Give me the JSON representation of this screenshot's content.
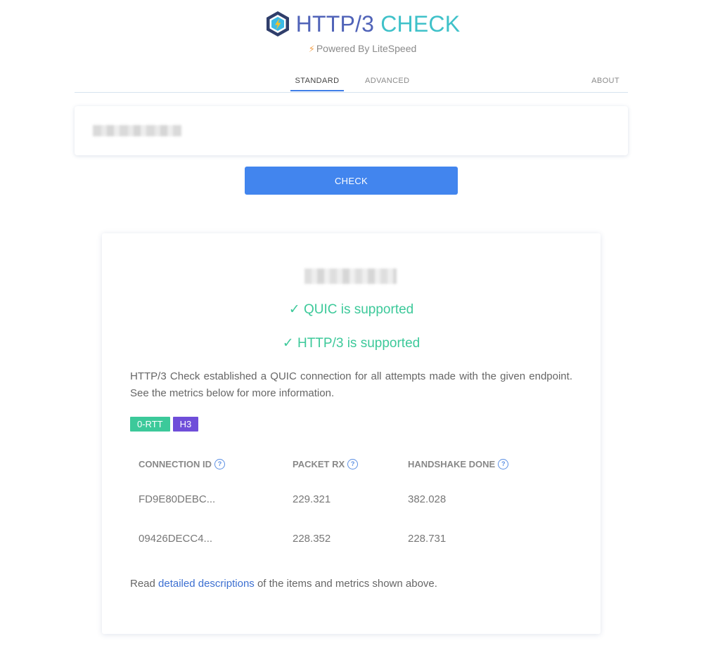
{
  "header": {
    "logo_http": "HTTP/3",
    "logo_check": "CHECK",
    "powered_by": "Powered By LiteSpeed"
  },
  "tabs": [
    {
      "label": "STANDARD",
      "active": true
    },
    {
      "label": "ADVANCED",
      "active": false
    },
    {
      "label": "ABOUT",
      "active": false
    }
  ],
  "input": {
    "value": "",
    "placeholder": ""
  },
  "check_button": {
    "label": "CHECK"
  },
  "result": {
    "quic_status": "✓ QUIC is supported",
    "h3_status": "✓ HTTP/3 is supported",
    "summary": "HTTP/3 Check established a QUIC connection for all attempts made with the given endpoint. See the metrics below for more information.",
    "badges": [
      "0-RTT",
      "H3"
    ],
    "table": {
      "headers": [
        "CONNECTION ID",
        "PACKET RX",
        "HANDSHAKE DONE"
      ],
      "rows": [
        [
          "FD9E80DEBC...",
          "229.321",
          "382.028"
        ],
        [
          "09426DECC4...",
          "228.352",
          "228.731"
        ]
      ]
    },
    "read_prefix": "Read ",
    "read_link": "detailed descriptions",
    "read_suffix": " of the items and metrics shown above."
  },
  "colors": {
    "brand_blue": "#5063b8",
    "brand_teal": "#3fc1c9",
    "button": "#4285ee",
    "success": "#3dc99a",
    "badge_0rtt": "#3cc99a",
    "badge_h3": "#6f4ed9",
    "link": "#3c6fd1"
  }
}
